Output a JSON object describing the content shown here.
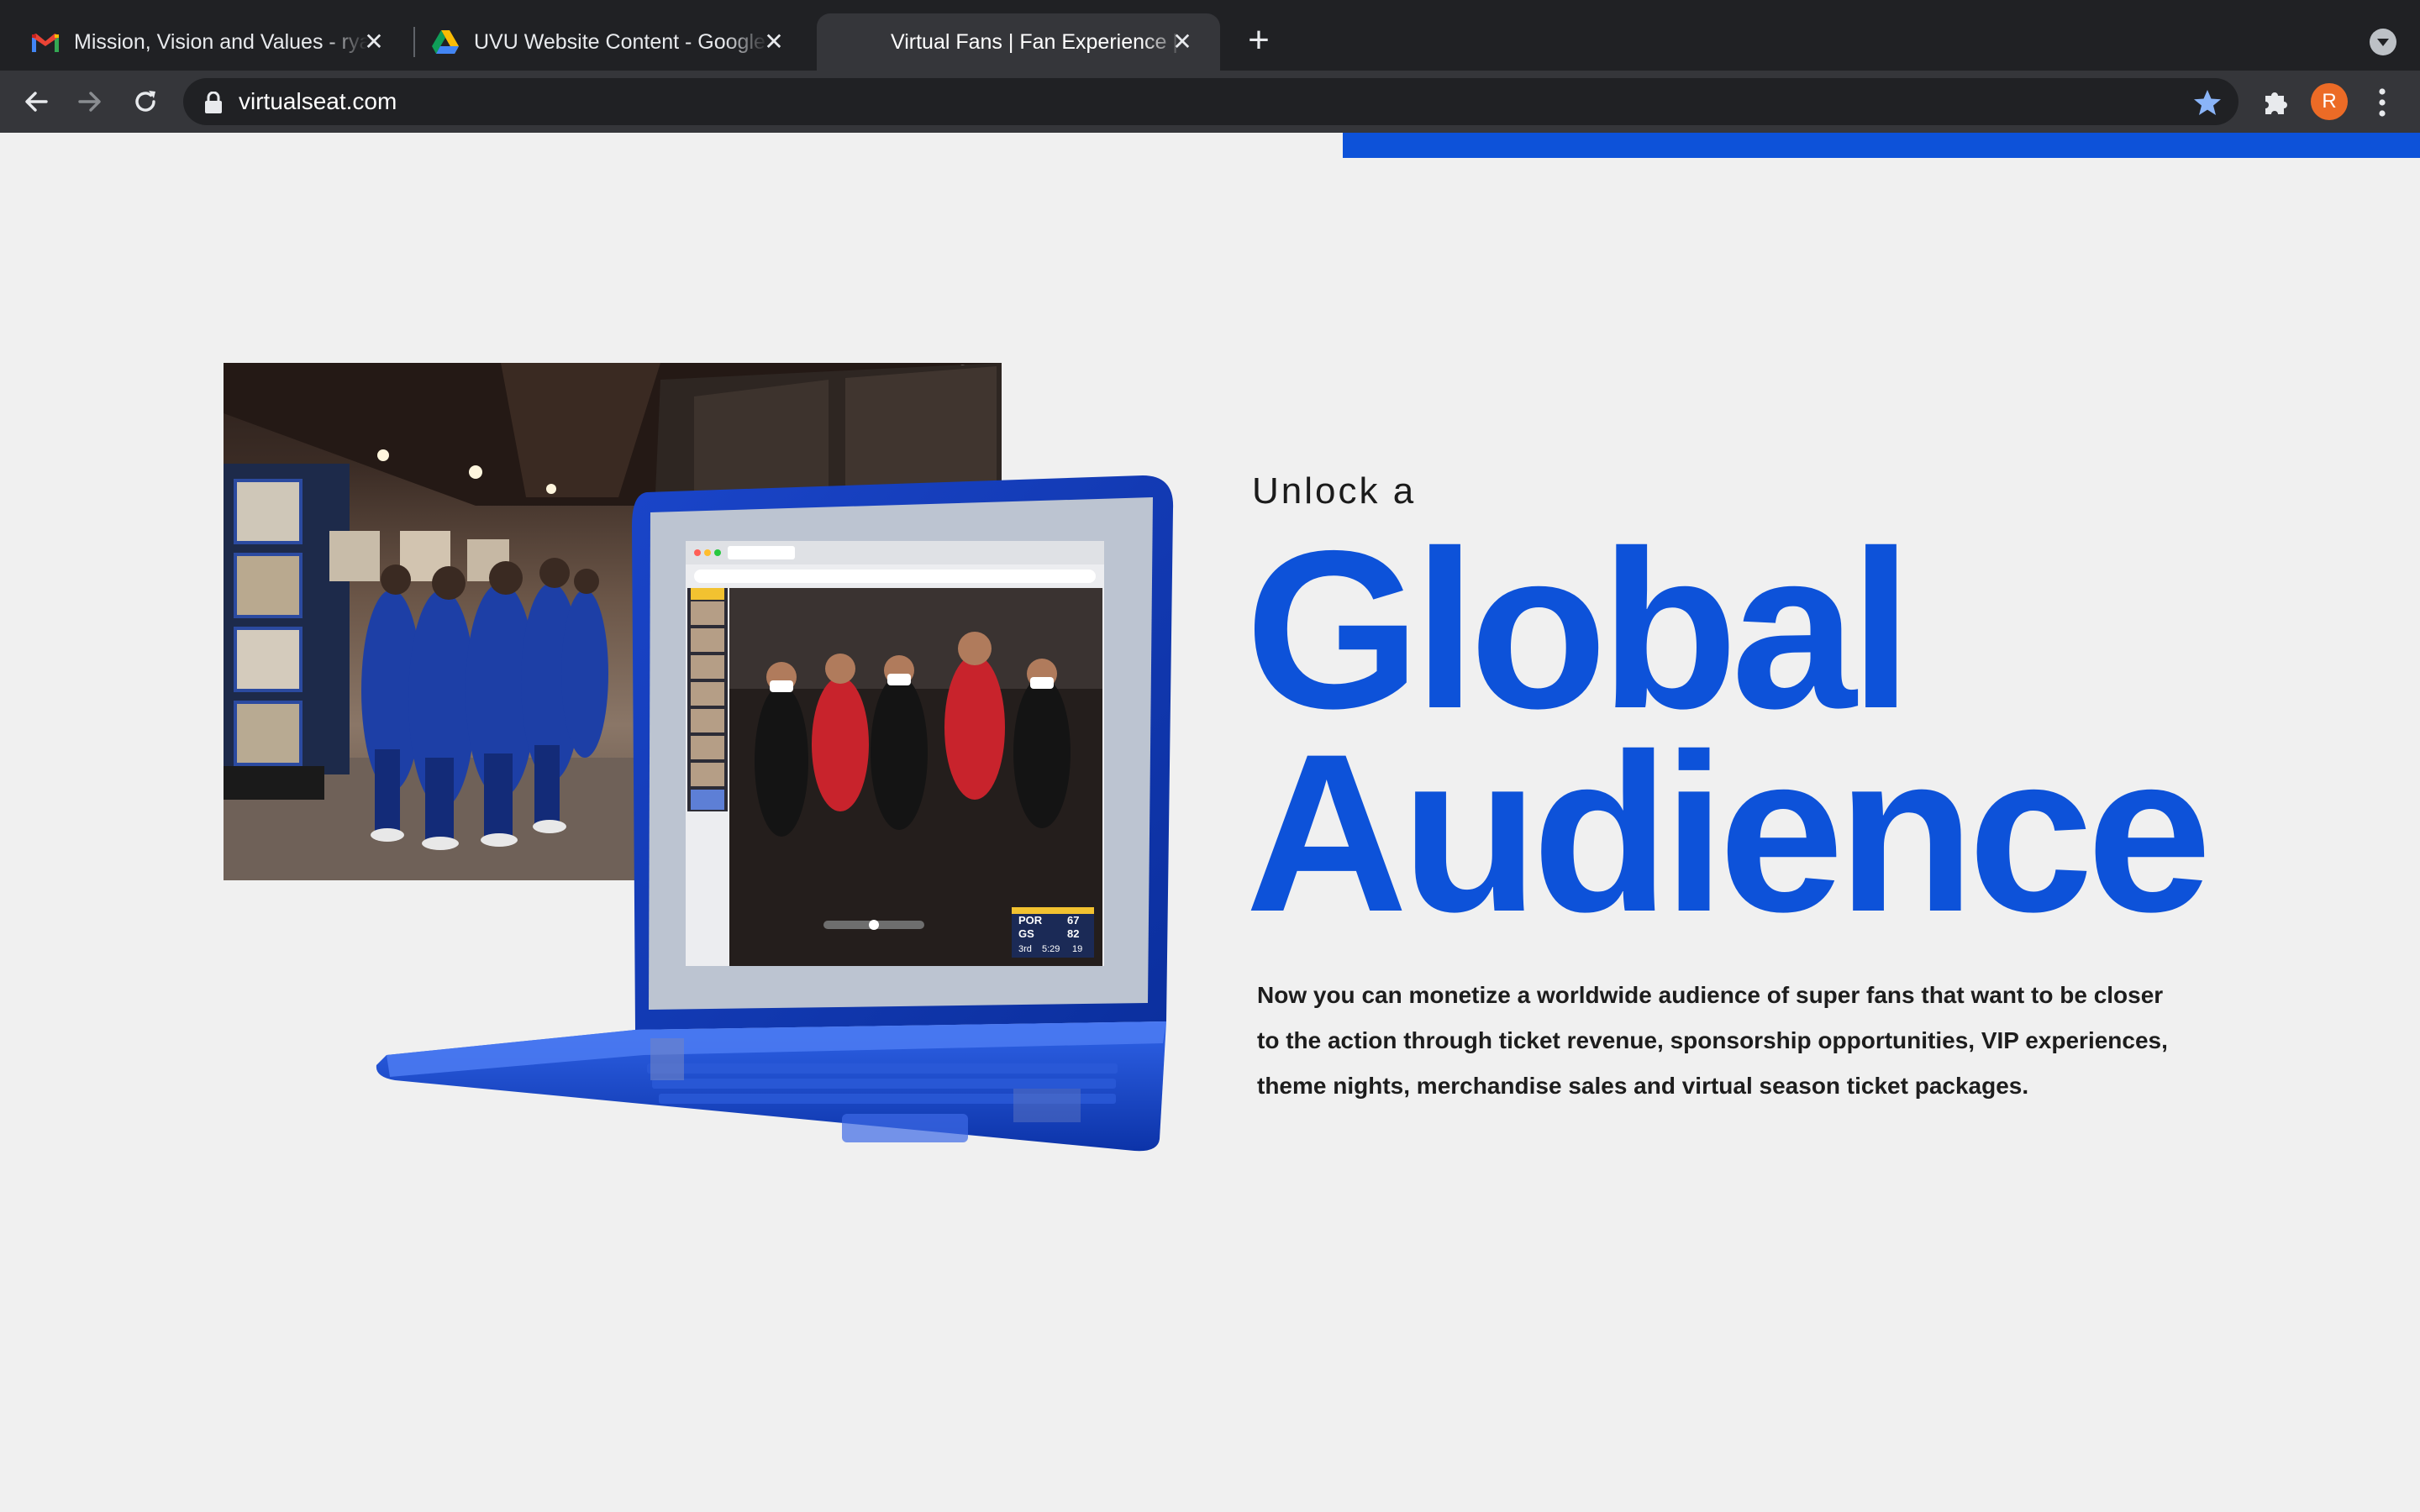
{
  "browser": {
    "tabs": [
      {
        "title": "Mission, Vision and Values - ryan",
        "favicon": "gmail-icon",
        "active": false
      },
      {
        "title": "UVU Website Content - Google Drive",
        "favicon": "google-drive-icon",
        "active": false
      },
      {
        "title": "Virtual Fans | Fan Experience | Vir",
        "favicon": "blank-favicon",
        "active": true
      }
    ],
    "new_tab_label": "+",
    "close_glyph": "✕",
    "url": "virtualseat.com",
    "profile_initial": "R",
    "profile_color": "#ec6b26"
  },
  "page": {
    "accent_color": "#0d52d9",
    "kicker": "Unlock a",
    "headline_line1": "Global",
    "headline_line2": "Audience",
    "body": "Now you can monetize a worldwide audience of super fans that want to be closer to the action through ticket revenue, sponsorship opportunities, VIP experiences, theme nights, merchandise sales and virtual season ticket packages.",
    "scoreboard": {
      "home": "POR",
      "home_score": "67",
      "away": "GS",
      "away_score": "82",
      "period": "3rd",
      "clock": "5:29",
      "shot_clock": "19"
    }
  }
}
